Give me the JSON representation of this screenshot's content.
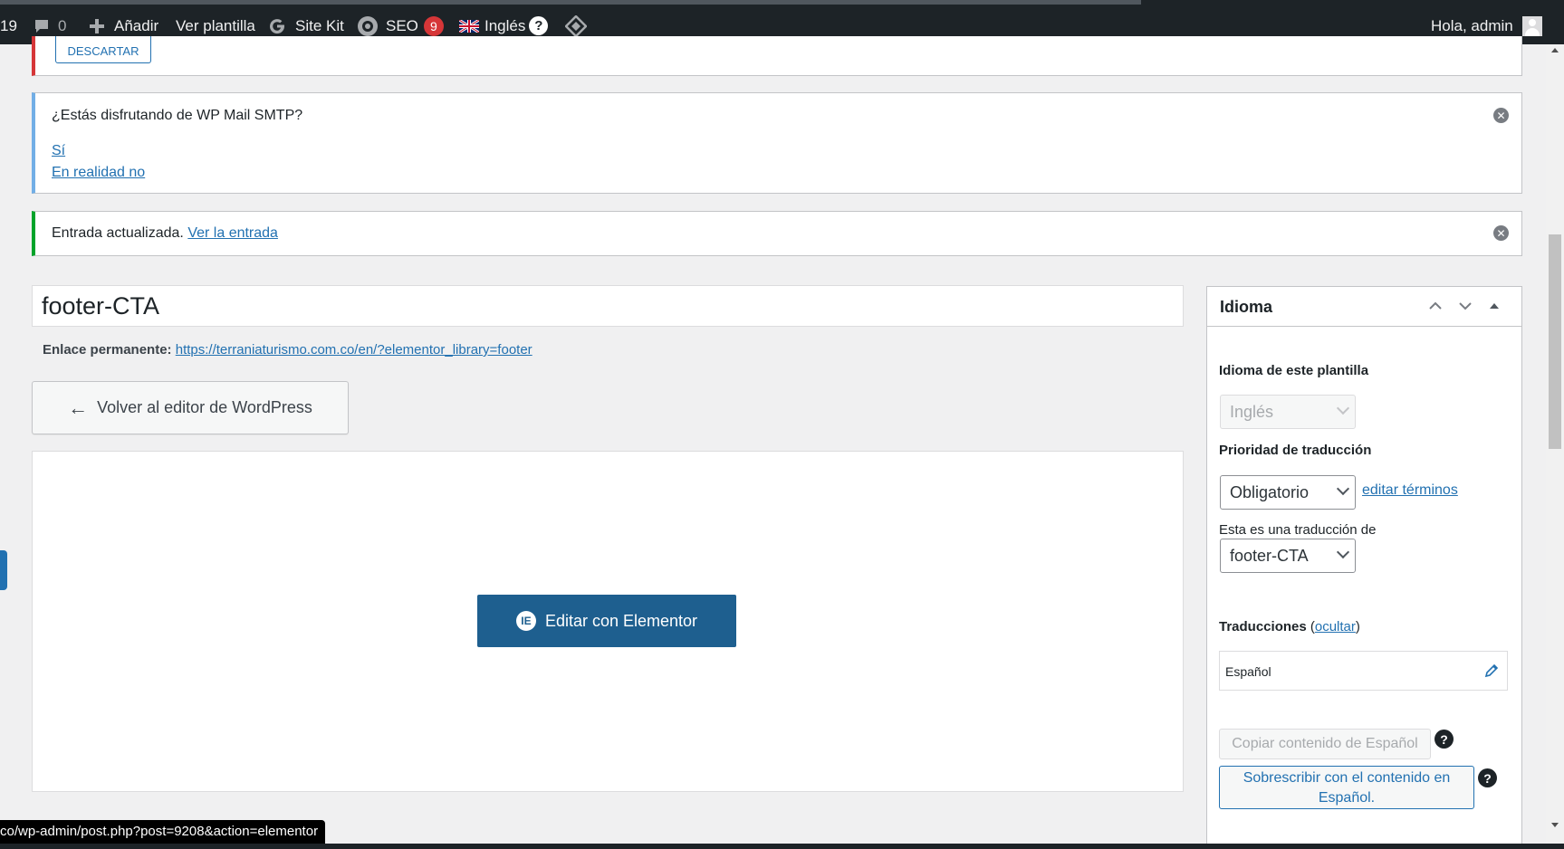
{
  "adminbar": {
    "partial_count": "19",
    "comments_count": "0",
    "add_label": "Añadir",
    "view_template_label": "Ver plantilla",
    "sitekit_label": "Site Kit",
    "seo_label": "SEO",
    "seo_badge": "9",
    "language_label": "Inglés",
    "help_glyph": "?",
    "greeting": "Hola, admin",
    "icons": [
      "comment-icon",
      "plus-icon",
      "google-g-icon",
      "seo-gear-icon",
      "uk-flag-icon",
      "help-icon",
      "diamond-icon",
      "avatar-icon"
    ]
  },
  "notices": {
    "discard_label": "DESCARTAR",
    "smtp_question": "¿Estás disfrutando de WP Mail SMTP?",
    "smtp_yes": "Sí",
    "smtp_no": "En realidad no",
    "updated_text": "Entrada actualizada.",
    "updated_link": "Ver la entrada",
    "dismiss_glyph": "✕"
  },
  "editor": {
    "title_value": "footer-CTA",
    "permalink_label": "Enlace permanente:",
    "permalink_url": "https://terraniaturismo.com.co/en/?elementor_library=footer",
    "back_label": "Volver al editor de WordPress",
    "elementor_label": "Editar con Elementor",
    "elementor_glyph": "IE"
  },
  "language_box": {
    "title": "Idioma",
    "template_language_label": "Idioma de este plantilla",
    "template_language_value": "Inglés",
    "priority_label": "Prioridad de traducción",
    "priority_value": "Obligatorio",
    "edit_terms_label": "editar términos",
    "translation_of_label": "Esta es una traducción de",
    "translation_of_value": "footer-CTA",
    "translations_label": "Traducciones",
    "hide_link": "ocultar",
    "paren_open": "(",
    "paren_close": ")",
    "translation_lang": "Español",
    "copy_button": "Copiar contenido de Español",
    "overwrite_button": "Sobrescribir con el contenido en Español.",
    "help_glyph": "?"
  },
  "status_bar": {
    "url": "co/wp-admin/post.php?post=9208&action=elementor"
  },
  "colors": {
    "adminbar_bg": "#1d2327",
    "accent": "#2271b1",
    "elementor": "#1e5f8f",
    "notice_error": "#d63638",
    "notice_info": "#72aee6",
    "notice_success": "#00a32a"
  }
}
